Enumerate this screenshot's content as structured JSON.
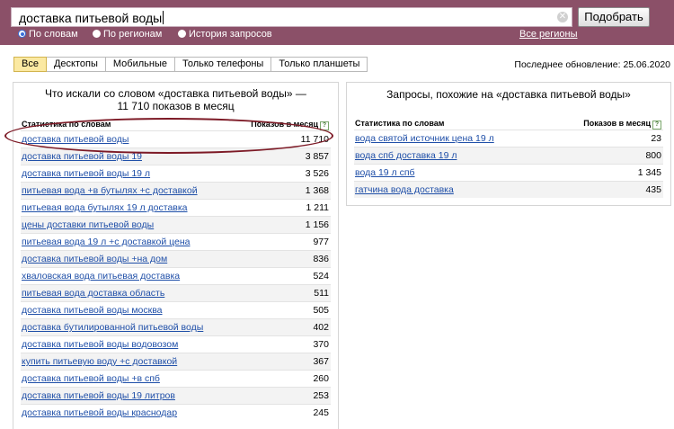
{
  "search": {
    "value": "доставка питьевой воды",
    "button_label": "Подобрать",
    "clear_icon": "✕"
  },
  "modes": [
    {
      "label": "По словам",
      "selected": true
    },
    {
      "label": "По регионам",
      "selected": false
    },
    {
      "label": "История запросов",
      "selected": false
    }
  ],
  "all_regions_label": "Все регионы",
  "device_tabs": [
    {
      "label": "Все",
      "active": true
    },
    {
      "label": "Десктопы",
      "active": false
    },
    {
      "label": "Мобильные",
      "active": false
    },
    {
      "label": "Только телефоны",
      "active": false
    },
    {
      "label": "Только планшеты",
      "active": false
    }
  ],
  "last_update": "Последнее обновление: 25.06.2020",
  "left_panel": {
    "title": "Что искали со словом «доставка питьевой воды» — 11 710 показов в месяц",
    "col_query": "Статистика по словам",
    "col_count": "Показов в месяц",
    "help_icon": "?",
    "rows": [
      {
        "query": "доставка питьевой воды",
        "count": "11 710"
      },
      {
        "query": "доставка питьевой воды 19",
        "count": "3 857"
      },
      {
        "query": "доставка питьевой воды 19 л",
        "count": "3 526"
      },
      {
        "query": "питьевая вода +в бутылях +с доставкой",
        "count": "1 368"
      },
      {
        "query": "питьевая вода бутылях 19 л доставка",
        "count": "1 211"
      },
      {
        "query": "цены доставки питьевой воды",
        "count": "1 156"
      },
      {
        "query": "питьевая вода 19 л +с доставкой цена",
        "count": "977"
      },
      {
        "query": "доставка питьевой воды +на дом",
        "count": "836"
      },
      {
        "query": "хваловская вода питьевая доставка",
        "count": "524"
      },
      {
        "query": "питьевая вода доставка область",
        "count": "511"
      },
      {
        "query": "доставка питьевой воды москва",
        "count": "505"
      },
      {
        "query": "доставка бутилированной питьевой воды",
        "count": "402"
      },
      {
        "query": "доставка питьевой воды водовозом",
        "count": "370"
      },
      {
        "query": "купить питьевую воду +с доставкой",
        "count": "367"
      },
      {
        "query": "доставка питьевой воды +в спб",
        "count": "260"
      },
      {
        "query": "доставка питьевой воды 19 литров",
        "count": "253"
      },
      {
        "query": "доставка питьевой воды краснодар",
        "count": "245"
      }
    ]
  },
  "right_panel": {
    "title": "Запросы, похожие на «доставка питьевой воды»",
    "col_query": "Статистика по словам",
    "col_count": "Показов в месяц",
    "help_icon": "?",
    "rows": [
      {
        "query": "вода святой источник цена 19 л",
        "count": "23"
      },
      {
        "query": "вода спб доставка 19 л",
        "count": "800"
      },
      {
        "query": "вода 19 л спб",
        "count": "1 345"
      },
      {
        "query": "гатчина вода доставка",
        "count": "435"
      }
    ]
  }
}
